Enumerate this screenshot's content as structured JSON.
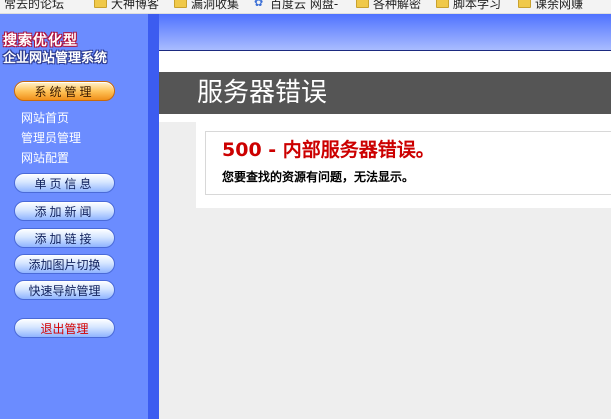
{
  "bookmarks": [
    {
      "label": "常去的论坛",
      "icon": "folder-icon"
    },
    {
      "label": "大神博客",
      "icon": "folder-icon"
    },
    {
      "label": "漏洞收集",
      "icon": "folder-icon"
    },
    {
      "label": "百度云 网盘-",
      "icon": "baidu-paw-icon"
    },
    {
      "label": "各种解密",
      "icon": "folder-icon"
    },
    {
      "label": "脚本学习",
      "icon": "folder-icon"
    },
    {
      "label": "课余网赚",
      "icon": "folder-icon"
    }
  ],
  "logo": {
    "line1": "搜索优化型",
    "line2": "企业网站管理系统"
  },
  "sidebar": {
    "system_label": "系统管理",
    "system_links": [
      "网站首页",
      "管理员管理",
      "网站配置"
    ],
    "menu": [
      "单页信息",
      "添加新闻",
      "添加链接",
      "添加图片切换",
      "快速导航管理"
    ],
    "logout_label": "退出管理"
  },
  "error": {
    "header": "服务器错误",
    "title": "500 - 内部服务器错误。",
    "message": "您要查找的资源有问题，无法显示。"
  },
  "colors": {
    "sidebar": "#6b8cff",
    "sidebar_edge": "#3c5cf0",
    "error_title": "#cc0000",
    "header_band": "#555555"
  }
}
